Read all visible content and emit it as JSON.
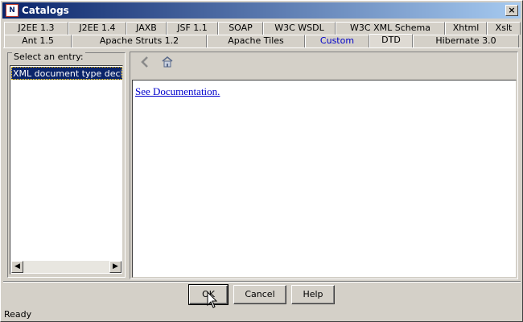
{
  "window": {
    "title": "Catalogs",
    "app_icon_text": "N",
    "close_label": "×"
  },
  "tabs_row1": [
    "J2EE 1.3",
    "J2EE 1.4",
    "JAXB",
    "JSF 1.1",
    "SOAP",
    "W3C WSDL",
    "W3C XML Schema",
    "Xhtml",
    "Xslt"
  ],
  "tabs_row2": [
    "Ant 1.5",
    "Apache Struts 1.2",
    "Apache Tiles",
    "Custom",
    "DTD",
    "Hibernate 3.0"
  ],
  "selected_tab": "DTD",
  "left_panel": {
    "group_label": "Select an entry:",
    "items": [
      "XML document type declarat"
    ],
    "selected_item": "XML document type declarat"
  },
  "toolbar": {
    "back_icon": "back-arrow-icon",
    "home_icon": "home-icon"
  },
  "content": {
    "link_text": "See Documentation."
  },
  "buttons": {
    "ok": "OK",
    "cancel": "Cancel",
    "help": "Help"
  },
  "status": {
    "text": "Ready"
  },
  "colors": {
    "titlebar_start": "#0a246a",
    "titlebar_end": "#a6caf0",
    "selection": "#0a246a",
    "link": "#0000cc",
    "custom_tab": "#0000c8"
  }
}
